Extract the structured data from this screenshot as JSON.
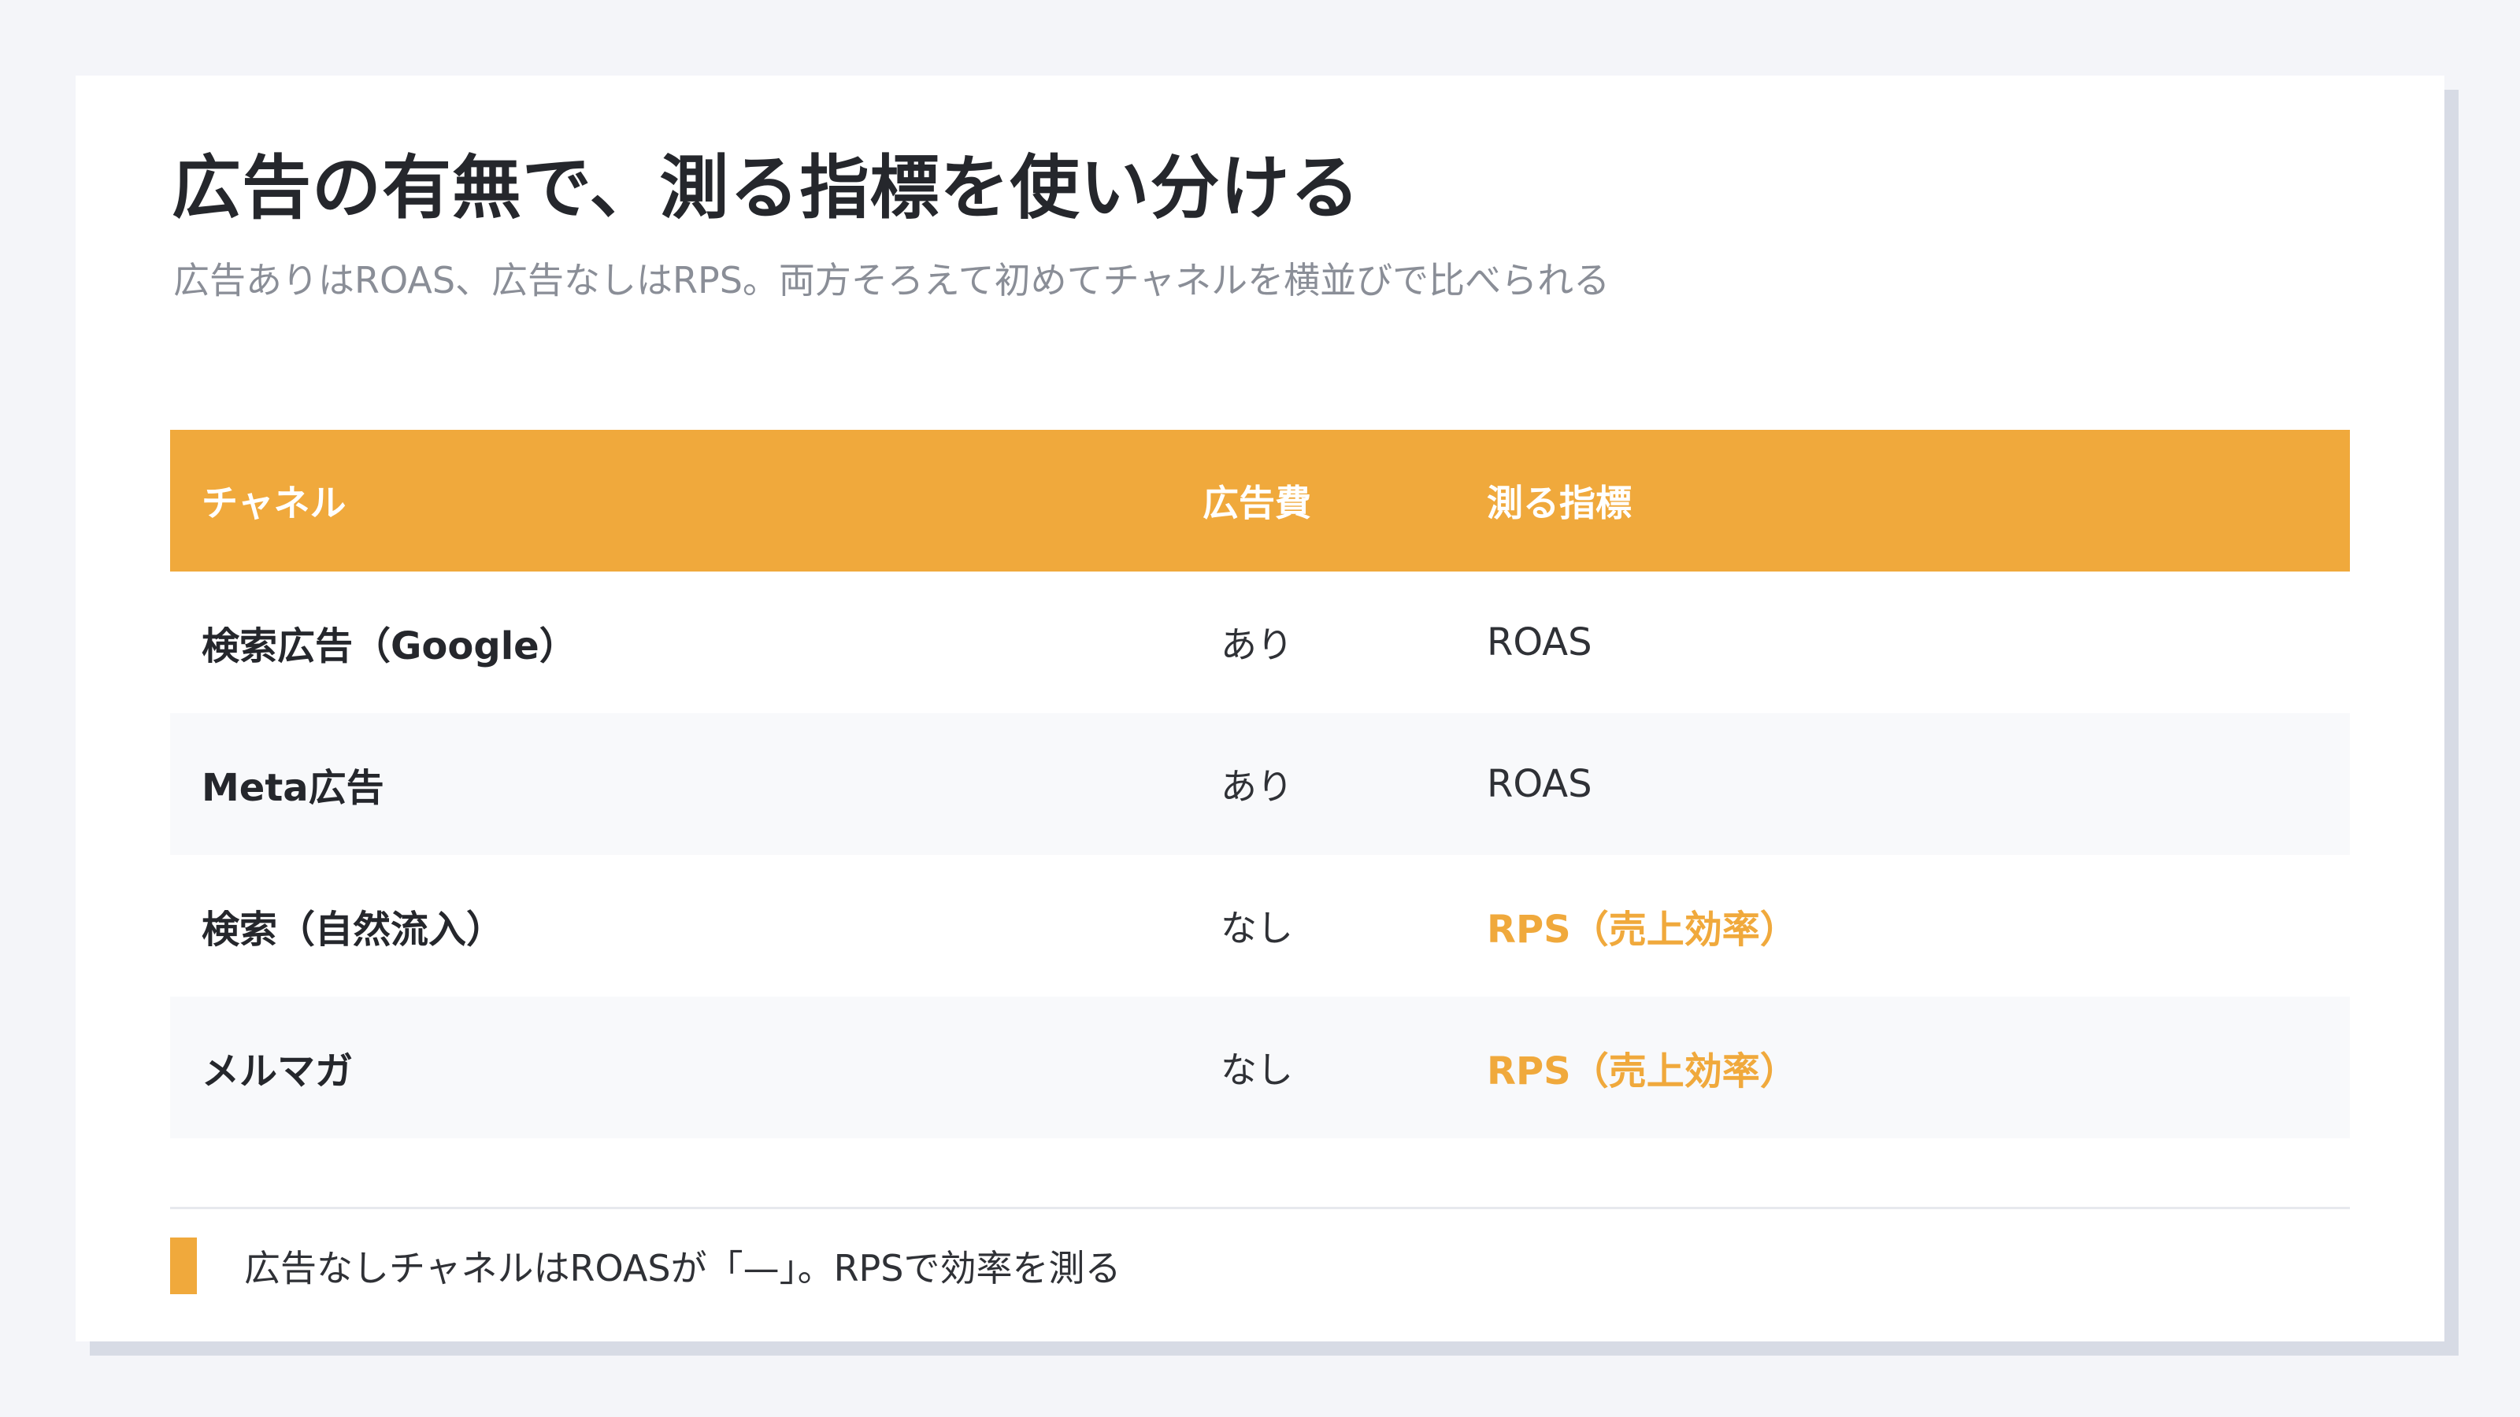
{
  "title": "広告の有無で、測る指標を使い分ける",
  "subtitle": "広告ありはROAS、広告なしはRPS。両方そろえて初めてチャネルを横並びで比べられる",
  "table": {
    "headers": {
      "channel": "チャネル",
      "ad_spend": "広告費",
      "metric": "測る指標"
    },
    "rows": [
      {
        "channel": "検索広告（Google）",
        "ad_spend": "あり",
        "metric": "ROAS"
      },
      {
        "channel": "Meta広告",
        "ad_spend": "あり",
        "metric": "ROAS"
      },
      {
        "channel": "検索（自然流入）",
        "ad_spend": "なし",
        "metric": "RPS（売上効率）"
      },
      {
        "channel": "メルマガ",
        "ad_spend": "なし",
        "metric": "RPS（売上効率）"
      }
    ]
  },
  "note": "広告なしチャネルはROASが「—」。RPSで効率を測る",
  "colors": {
    "accent": "#f0a93c",
    "background": "#f4f5f9",
    "text": "#25272c",
    "subtext": "#8a8e97"
  }
}
